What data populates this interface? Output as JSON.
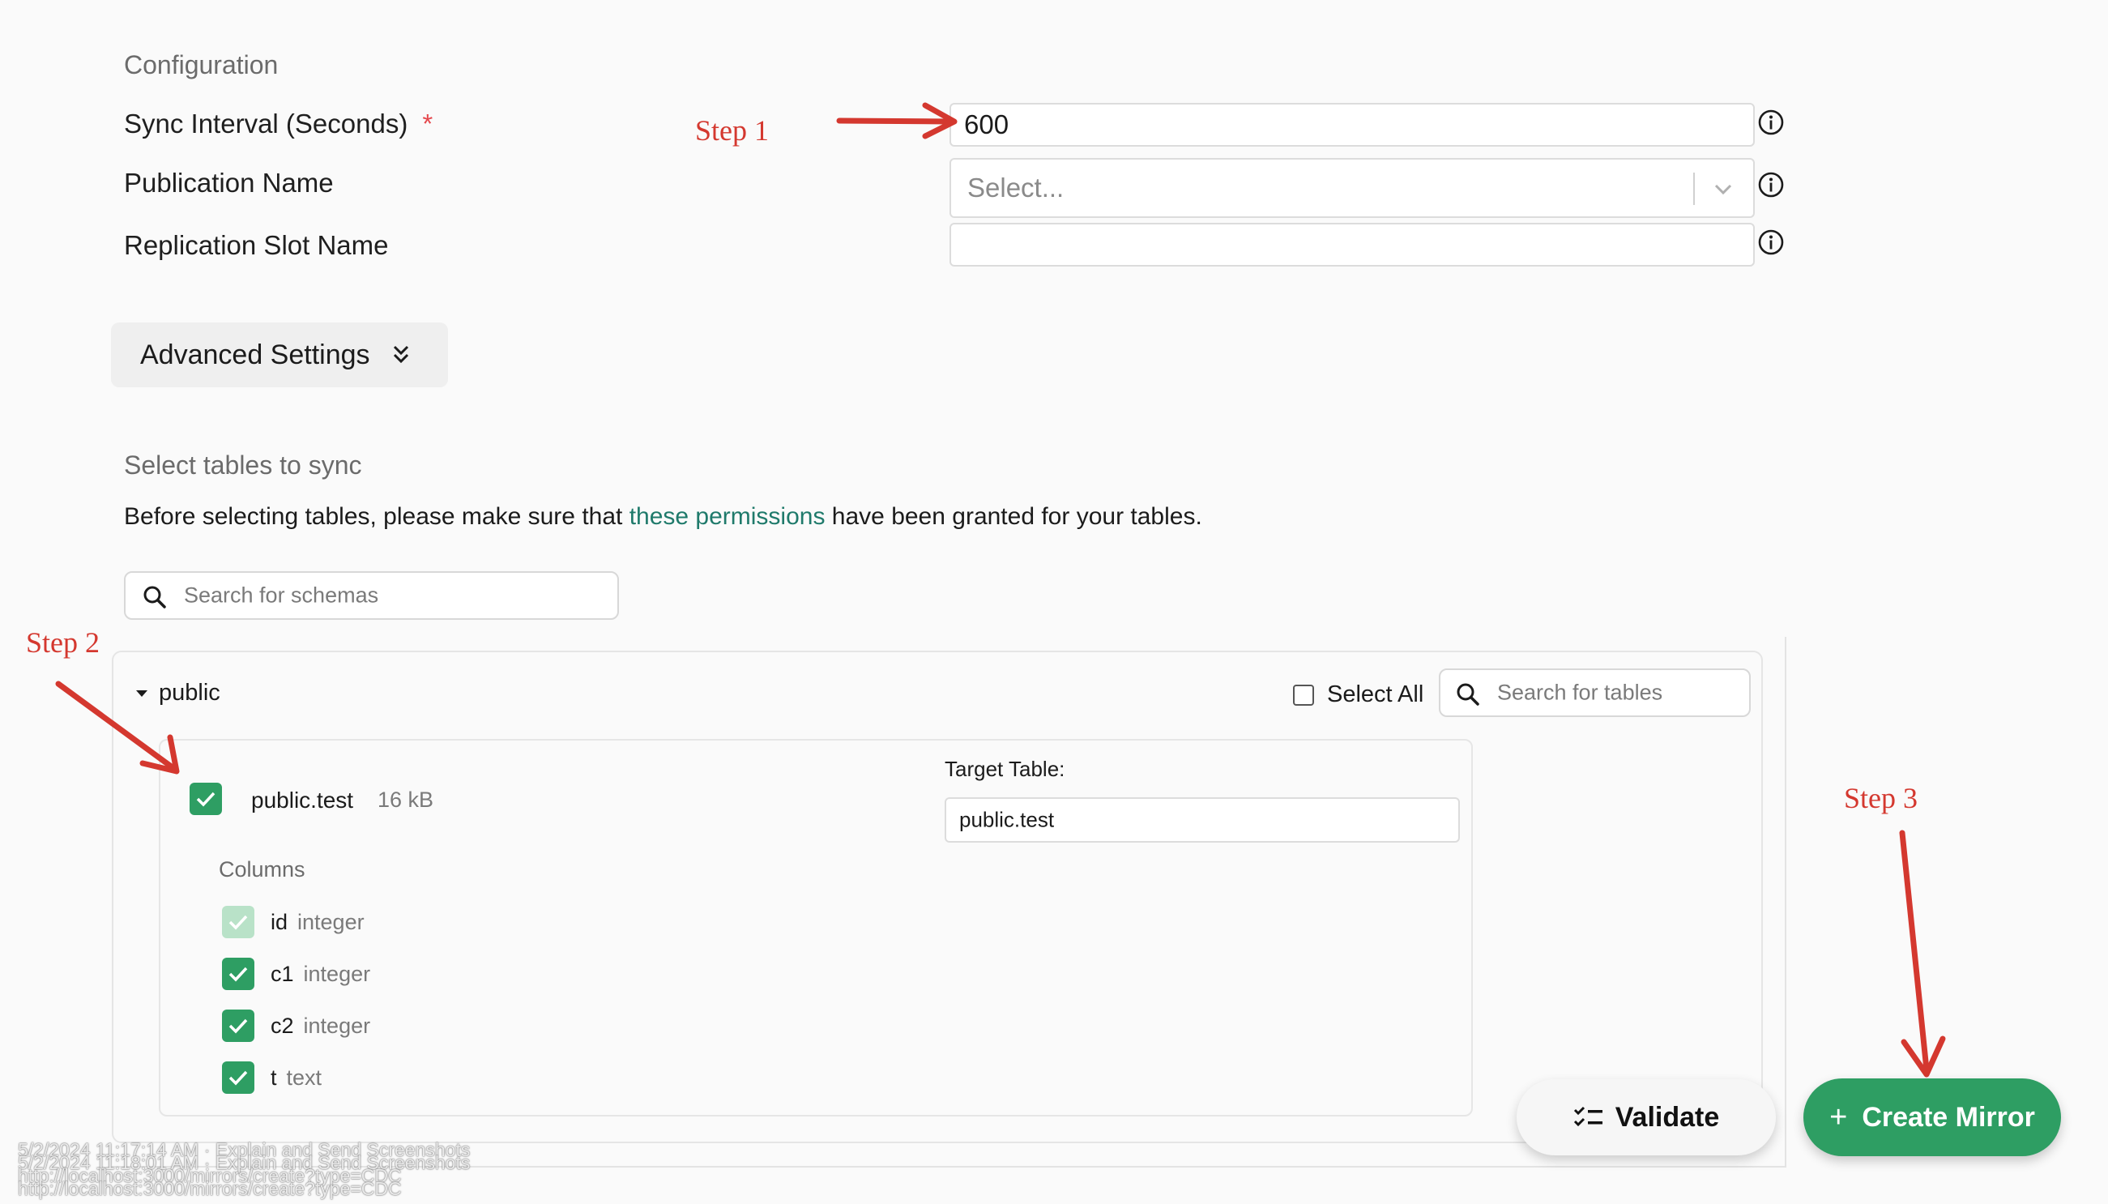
{
  "configuration": {
    "title": "Configuration",
    "sync_interval_label": "Sync Interval (Seconds)",
    "required_mark": "*",
    "sync_interval_value": "600",
    "publication_name_label": "Publication Name",
    "publication_placeholder": "Select...",
    "replication_slot_label": "Replication Slot Name",
    "replication_slot_value": ""
  },
  "advanced_settings": {
    "label": "Advanced Settings"
  },
  "tables_section": {
    "title": "Select tables to sync",
    "description_before": "Before selecting tables, please make sure that ",
    "permissions_link": "these permissions",
    "description_after": " have been granted for your tables.",
    "schema_search_placeholder": "Search for schemas",
    "schema_name": "public",
    "select_all_label": "Select All",
    "table_search_placeholder": "Search for tables",
    "table": {
      "name": "public.test",
      "size": "16 kB",
      "target_label": "Target Table:",
      "target_value": "public.test",
      "columns_label": "Columns",
      "columns": [
        {
          "name": "id",
          "type": "integer",
          "disabled": true
        },
        {
          "name": "c1",
          "type": "integer",
          "disabled": false
        },
        {
          "name": "c2",
          "type": "integer",
          "disabled": false
        },
        {
          "name": "t",
          "type": "text",
          "disabled": false
        }
      ]
    }
  },
  "annotations": {
    "step1": "Step 1",
    "step2": "Step 2",
    "step3": "Step 3"
  },
  "actions": {
    "validate_label": "Validate",
    "create_label": "Create Mirror"
  },
  "watermark": {
    "line1": "5/2/2024 11:17:14 AM · Explain and Send Screenshots",
    "line2": "5/2/2024 11:18:01 AM · Explain and Send Screenshots",
    "line3": "http://localhost:3000/mirrors/create?type=CDC",
    "line4": "http://localhost:3000/mirrors/create?type=CDC"
  },
  "colors": {
    "accent_green": "#2e9e63",
    "link_teal": "#1f7a6b",
    "annotation_red": "#d4382f",
    "required_red": "#e5484d"
  }
}
